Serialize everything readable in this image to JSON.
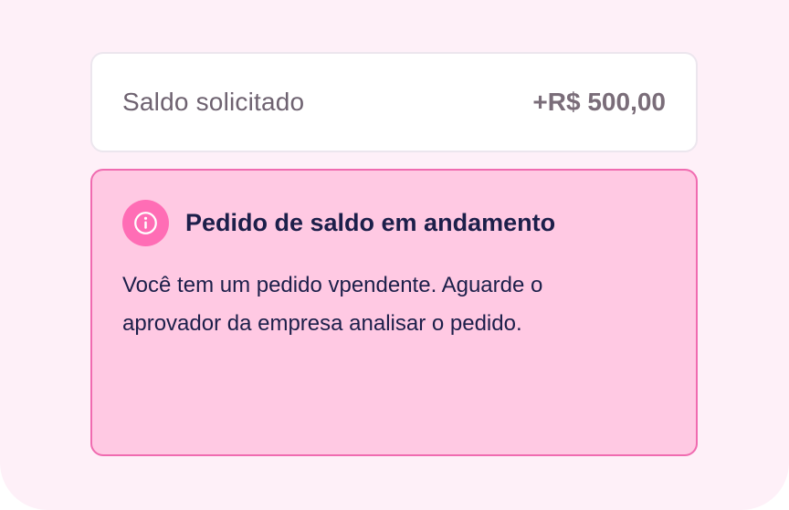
{
  "balance": {
    "label": "Saldo solicitado",
    "value": "+R$ 500,00"
  },
  "alert": {
    "icon": "info-icon",
    "title": "Pedido de saldo em andamento",
    "message": "Você tem um pedido vpendente. Aguarde o aprovador da empresa analisar o pedido."
  },
  "colors": {
    "page_background": "#fef0f8",
    "alert_background": "#ffc9e3",
    "alert_border": "#f06bb0",
    "icon_badge": "#ff6db5",
    "title_text": "#1c1f4a"
  }
}
